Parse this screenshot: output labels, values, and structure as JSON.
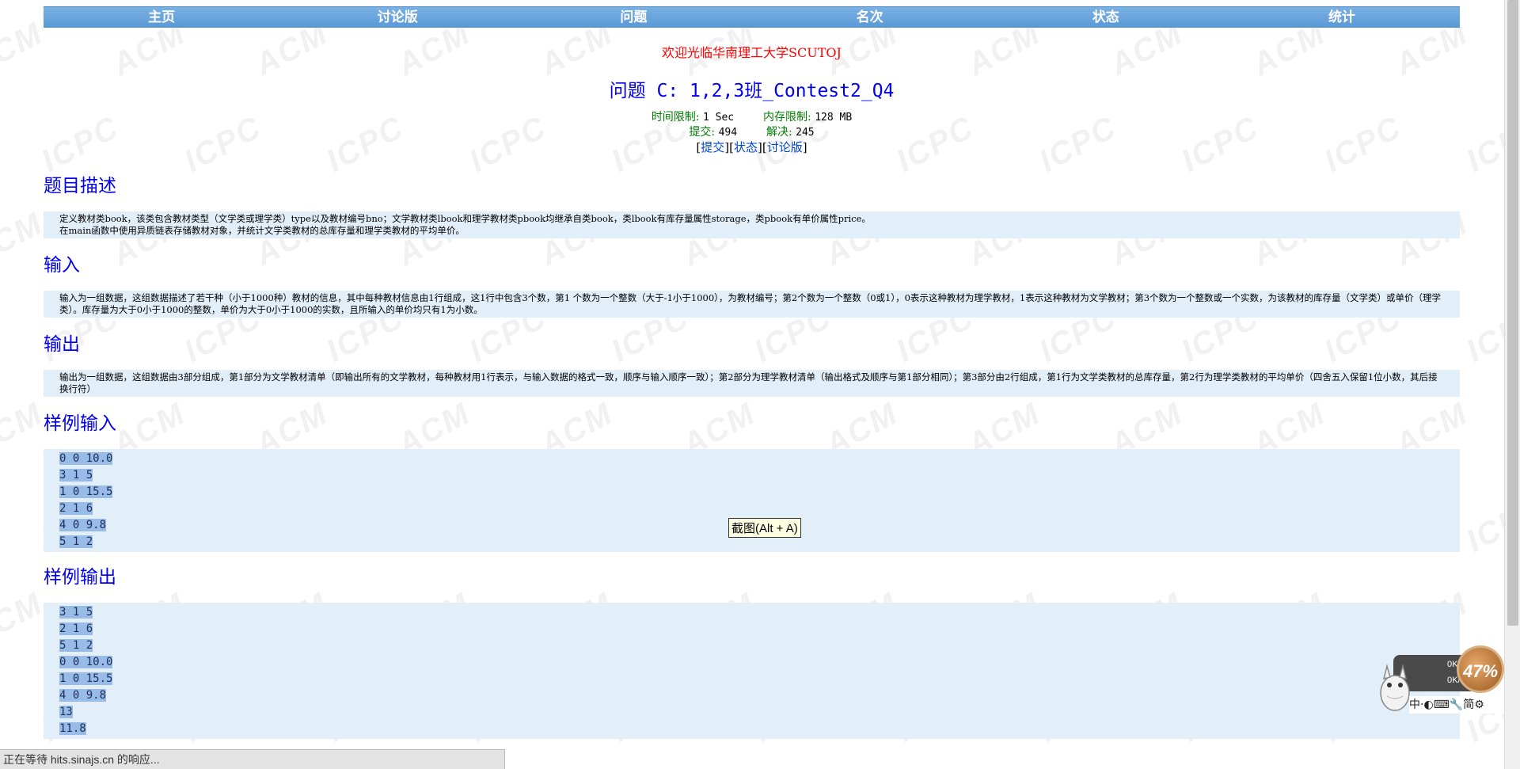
{
  "nav": {
    "items": [
      "主页",
      "讨论版",
      "问题",
      "名次",
      "状态",
      "统计"
    ]
  },
  "welcome": "欢迎光临华南理工大学SCUTOJ",
  "problem": {
    "title": "问题 C: 1,2,3班_Contest2_Q4",
    "time_limit_label": "时间限制:",
    "time_limit_value": "1 Sec",
    "memory_limit_label": "内存限制:",
    "memory_limit_value": "128 MB",
    "submit_label": "提交:",
    "submit_value": "494",
    "solved_label": "解决:",
    "solved_value": "245",
    "links": [
      "提交",
      "状态",
      "讨论版"
    ]
  },
  "sections": {
    "description": {
      "title": "题目描述",
      "lines": [
        "定义教材类book，该类包含教材类型（文学类或理学类）type以及教材编号bno；文学教材类lbook和理学教材类pbook均继承自类book，类lbook有库存量属性storage，类pbook有单价属性price。",
        "在main函数中使用异质链表存储教材对象，并统计文学类教材的总库存量和理学类教材的平均单价。"
      ]
    },
    "input": {
      "title": "输入",
      "text": "输入为一组数据，这组数据描述了若干种（小于1000种）教材的信息，其中每种教材信息由1行组成，这1行中包含3个数，第1 个数为一个整数（大于-1小于1000），为教材编号；第2个数为一个整数（0或1），0表示这种教材为理学教材，1表示这种教材为文学教材；第3个数为一个整数或一个实数，为该教材的库存量（文学类）或单价（理学类）。库存量为大于0小于1000的整数，单价为大于0小于1000的实数，且所输入的单价均只有1为小数。"
    },
    "output": {
      "title": "输出",
      "text": "输出为一组数据，这组数据由3部分组成，第1部分为文学教材清单（即输出所有的文学教材，每种教材用1行表示，与输入数据的格式一致，顺序与输入顺序一致）；第2部分为理学教材清单（输出格式及顺序与第1部分相同）；第3部分由2行组成，第1行为文学类教材的总库存量，第2行为理学类教材的平均单价（四舍五入保留1位小数，其后接换行符）"
    },
    "sample_input": {
      "title": "样例输入",
      "lines": [
        "0 0 10.0",
        "3 1 5",
        "1 0 15.5",
        "2 1 6",
        "4 0 9.8",
        "5 1 2"
      ]
    },
    "sample_output": {
      "title": "样例输出",
      "lines": [
        "3 1 5",
        "2 1 6",
        "5 1 2",
        "0 0 10.0",
        "1 0 15.5",
        "4 0 9.8",
        "13",
        "11.8"
      ]
    }
  },
  "tooltip": "截图(Alt + A)",
  "status_bar": "正在等待 hits.sinajs.cn 的响应...",
  "widget": {
    "up_speed": "0K/s",
    "down_speed": "0K/s",
    "percent": "47%",
    "ime_text": "中·◐⌨🔧简⚙"
  },
  "watermark_text": "ACM ICPC"
}
